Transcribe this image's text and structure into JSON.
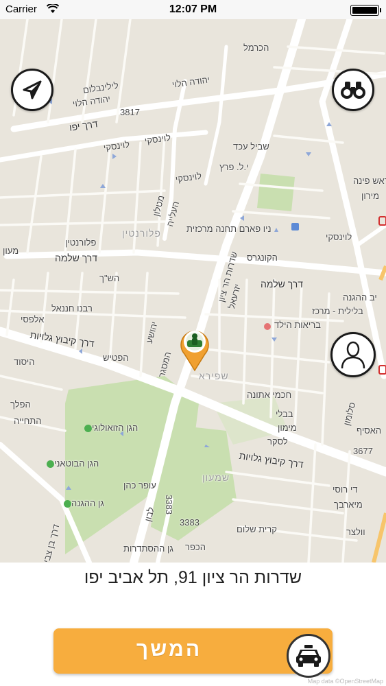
{
  "status_bar": {
    "carrier": "Carrier",
    "time": "12:07 PM"
  },
  "map": {
    "labels": {
      "hakarmel": "הכרמל",
      "yehuda_halevi_top": "יהודה הלוי",
      "lilienblum": "לילינבלום",
      "yehuda_halevi_2": "יהודה הלוי",
      "num_3817": "3817",
      "derech_yafo": "דרך יפו",
      "levinsky_1": "לוינסקי",
      "levinsky_2": "לוינסקי",
      "levinsky_3": "לוינסקי",
      "shvil_ezed": "שביל עכד",
      "yl_peretz": "י.ל. פרץ",
      "matalon": "מטלון",
      "haaliya": "העלייה",
      "florentin_district": "פלורנטין",
      "florentin": "פלורנטין",
      "nir_parm": "ניו פארם תחנה מרכזית",
      "hakongres": "הקונגרס",
      "derech_shlomo_1": "דרך שלמה",
      "derech_shlomo_2": "דרך שלמה",
      "haganah": "יב ההגנה",
      "rosh_pina": "ראש פינה",
      "miron": "מירון",
      "levinsky_right": "לוינסקי",
      "mayan": "מעון",
      "hash": "הש\"ך",
      "rabbenu_hananel": "רבנו חננאל",
      "alfasi": "אלפסי",
      "derech_kibbutz_galuyot_1": "דרך קיבוץ גלויות",
      "derech_kibbutz_galuyot_2": "דרך קיבוץ גלויות",
      "hayesod": "היסוד",
      "hapatish": "הפטיש",
      "shapira": "שפירא",
      "hachmei_atuna": "חכמי אתונה",
      "bavli": "בבלי",
      "maimon": "מימון",
      "laskar": "לסקר",
      "health_center": "בריאות הילד",
      "beit_balilit": "בלילית - מרכז",
      "hashal": "הפלך",
      "hatchiya": "התחייה",
      "zoo_garden": "הגן הזואולוגי",
      "botanic_garden": "הגן הבוטאני",
      "gan_hahagana": "גן ההגנה",
      "ofer_kohen": "עופר כהן",
      "num_3383_1": "3383",
      "num_3383_2": "3383",
      "shmaon": "שמעון",
      "kiryat_shalom": "קרית שלום",
      "gan_hahistadrut": "גן ההסתדרות",
      "hakfar": "הכפר",
      "num_3677": "3677",
      "haasif": "האסיף",
      "di_rossi": "די רוסי",
      "mirbach": "מיארבך",
      "volzer": "וולצר",
      "derech_ben_zvi": "דרך בן צבי",
      "yehoshua": "יהושע",
      "lavon": "לבון",
      "hamasger": "המסגר",
      "hanoter": "יזרעאל",
      "salome": "סלומון",
      "hapanan": "שדרות הר ציון"
    }
  },
  "buttons": {
    "locate_icon": "navigation-arrow",
    "search_icon": "binoculars",
    "profile_icon": "person-silhouette"
  },
  "address": "שדרות הר ציון 91, תל אביב יפו",
  "continue_label": "המשך",
  "taxi_icon": "taxi",
  "attribution": "Map data ©OpenStreetMap",
  "colors": {
    "accent": "#f7ad3e",
    "pin": "#f0a030",
    "park": "#c9dfb0",
    "road": "#ffffff",
    "map_bg": "#e9e5dc"
  }
}
